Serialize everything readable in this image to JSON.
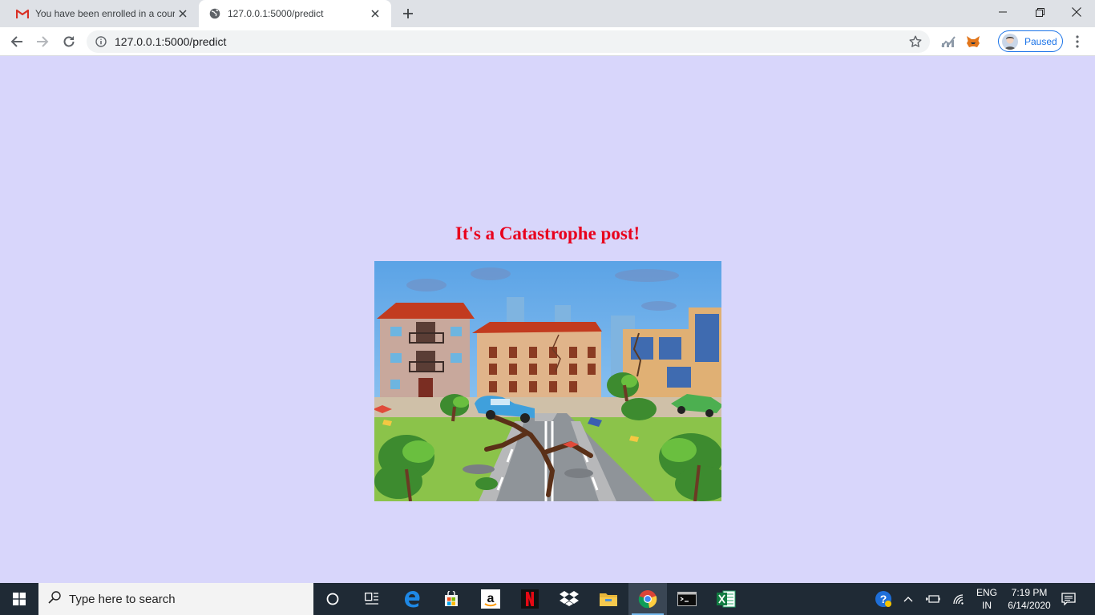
{
  "browser": {
    "tabs": [
      {
        "title": "You have been enrolled in a cour",
        "favicon": "gmail-icon",
        "active": false
      },
      {
        "title": "127.0.0.1:5000/predict",
        "favicon": "globe-icon",
        "active": true
      }
    ],
    "address": {
      "url": "127.0.0.1:5000/predict"
    },
    "profile": {
      "label": "Paused"
    }
  },
  "page": {
    "background": "#d8d6fb",
    "heading": "It's a Catastrophe post!",
    "heading_color": "#e8001c",
    "image": {
      "subject": "earthquake-damaged city street illustration"
    }
  },
  "taskbar": {
    "search_placeholder": "Type here to search",
    "apps": [
      "cortana-icon",
      "task-view-icon",
      "edge-icon",
      "store-icon",
      "amazon-icon",
      "netflix-icon",
      "dropbox-icon",
      "file-explorer-icon",
      "chrome-icon",
      "terminal-icon",
      "excel-icon"
    ],
    "lang": {
      "line1": "ENG",
      "line2": "IN"
    },
    "clock": {
      "time": "7:19 PM",
      "date": "6/14/2020"
    }
  }
}
